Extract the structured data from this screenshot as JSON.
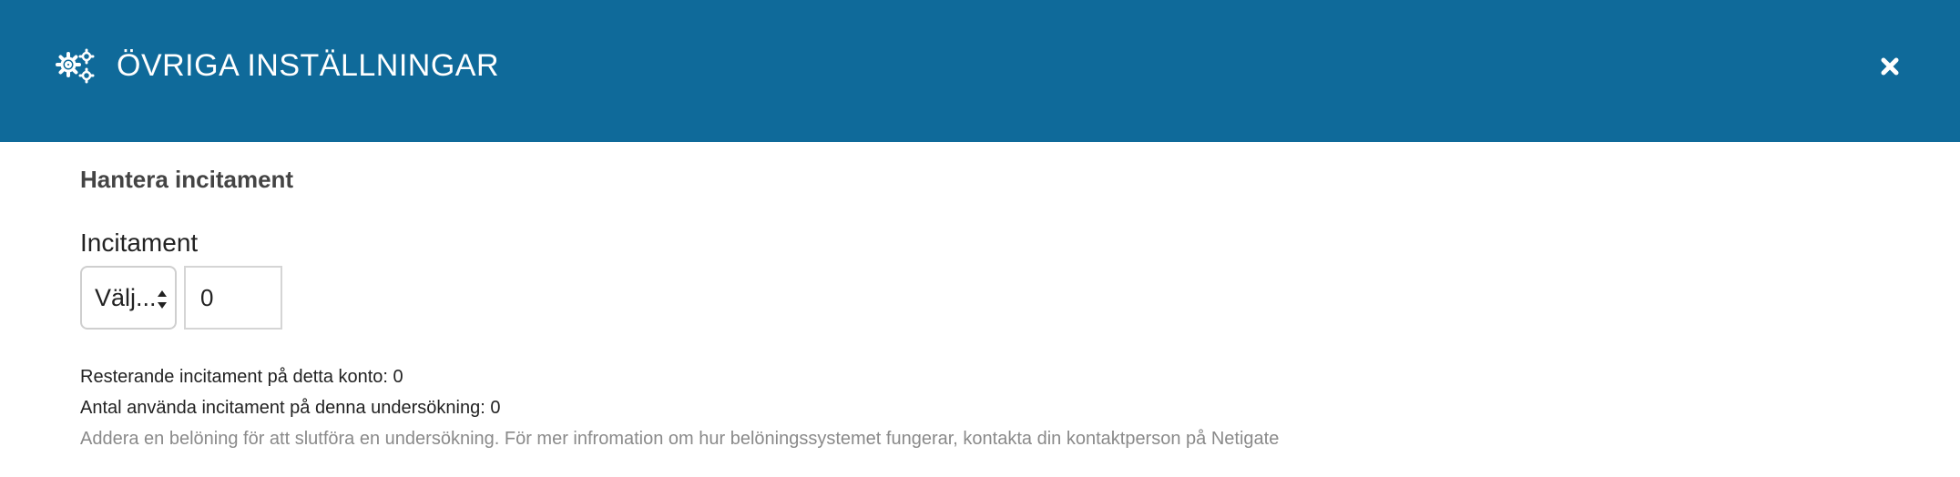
{
  "modal": {
    "title": "ÖVRIGA INSTÄLLNINGAR",
    "header_icon": "gears-icon",
    "close_icon": "close-icon",
    "colors": {
      "header_bg": "#0f6a9a",
      "header_text": "#ffffff"
    }
  },
  "incentive": {
    "section_title": "Hantera incitament",
    "field_label": "Incitament",
    "select": {
      "selected": "Välj..."
    },
    "amount_value": "0",
    "remaining_text": "Resterande incitament på detta konto: 0",
    "used_text": "Antal använda incitament på denna undersökning: 0",
    "help_text": "Addera en belöning för att slutföra en undersökning. För mer infromation om hur belöningssystemet fungerar, kontakta din kontaktperson på Netigate"
  }
}
